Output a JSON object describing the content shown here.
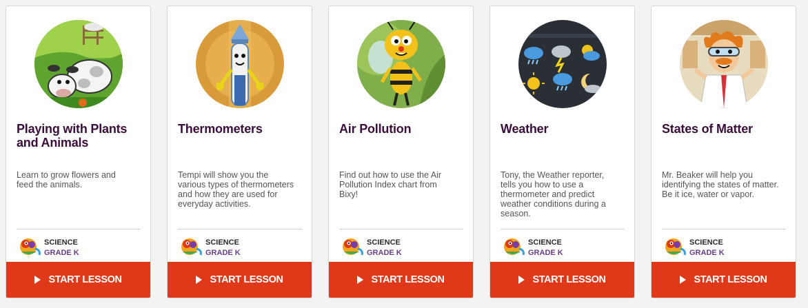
{
  "colors": {
    "title": "#3a0d3a",
    "button": "#e0391a",
    "grade": "#6a3d8a"
  },
  "lessons": [
    {
      "title": "Playing with Plants and Animals",
      "description": "Learn to grow flowers and feed the animals.",
      "image_icon": "cow-farm-icon",
      "subject": "SCIENCE",
      "grade": "GRADE K",
      "button_label": "START LESSON"
    },
    {
      "title": "Thermometers",
      "description": "Tempi will show you the various types of thermometers and how they are used for everyday activities.",
      "image_icon": "thermometer-character-icon",
      "subject": "SCIENCE",
      "grade": "GRADE K",
      "button_label": "START LESSON"
    },
    {
      "title": "Air Pollution",
      "description": "Find out how to use the Air Pollution Index chart from Bixy!",
      "image_icon": "bee-character-icon",
      "subject": "SCIENCE",
      "grade": "GRADE K",
      "button_label": "START LESSON"
    },
    {
      "title": "Weather",
      "description": "Tony, the Weather reporter, tells you how to use a thermometer and predict weather conditions during a season.",
      "image_icon": "weather-board-icon",
      "subject": "SCIENCE",
      "grade": "GRADE K",
      "button_label": "START LESSON"
    },
    {
      "title": "States of Matter",
      "description": "Mr. Beaker will help you identifying the states of matter. Be it ice, water or vapor.",
      "image_icon": "scientist-character-icon",
      "subject": "SCIENCE",
      "grade": "GRADE K",
      "button_label": "START LESSON"
    }
  ]
}
